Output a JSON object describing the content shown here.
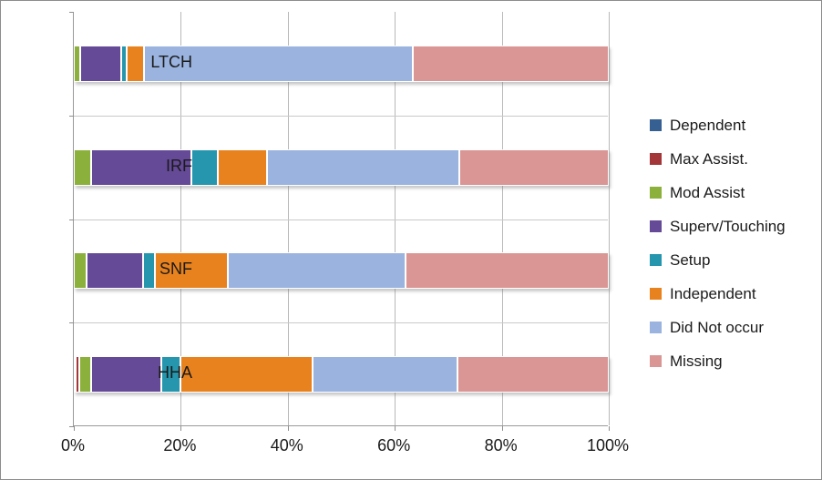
{
  "chart_data": {
    "type": "bar",
    "orientation": "horizontal",
    "stacked": true,
    "normalized_percent": true,
    "title": "",
    "xlabel": "",
    "ylabel": "",
    "xlim": [
      0,
      100
    ],
    "xticks": [
      "0%",
      "20%",
      "40%",
      "60%",
      "80%",
      "100%"
    ],
    "xtick_values": [
      0,
      20,
      40,
      60,
      80,
      100
    ],
    "grid": "vertical",
    "legend_position": "right",
    "categories": [
      "LTCH",
      "IRF",
      "SNF",
      "HHA"
    ],
    "series": [
      {
        "name": "Dependent",
        "color": "#376092",
        "values": [
          0.0,
          0.0,
          0.0,
          0.4
        ]
      },
      {
        "name": "Max Assist.",
        "color": "#a33639",
        "values": [
          0.0,
          0.0,
          0.0,
          0.6
        ]
      },
      {
        "name": "Mod Assist",
        "color": "#8cb03c",
        "values": [
          1.2,
          3.2,
          2.4,
          2.2
        ]
      },
      {
        "name": "Superv/Touching",
        "color": "#654a98",
        "values": [
          7.7,
          18.7,
          10.6,
          13.1
        ]
      },
      {
        "name": "Setup",
        "color": "#2596ad",
        "values": [
          0.9,
          5.1,
          2.2,
          3.6
        ]
      },
      {
        "name": "Independent",
        "color": "#e8821e",
        "values": [
          3.4,
          9.2,
          13.6,
          24.7
        ]
      },
      {
        "name": "Did Not occur",
        "color": "#9ab3df",
        "values": [
          50.1,
          35.9,
          33.2,
          27.2
        ]
      },
      {
        "name": "Missing",
        "color": "#d99694",
        "values": [
          36.7,
          27.9,
          38.0,
          28.2
        ]
      }
    ]
  },
  "legend": {
    "items": [
      {
        "label": "Dependent"
      },
      {
        "label": "Max Assist."
      },
      {
        "label": "Mod Assist"
      },
      {
        "label": "Superv/Touching"
      },
      {
        "label": "Setup"
      },
      {
        "label": "Independent"
      },
      {
        "label": "Did Not occur"
      },
      {
        "label": "Missing"
      }
    ]
  },
  "axis": {
    "y_categories": [
      "LTCH",
      "IRF",
      "SNF",
      "HHA"
    ],
    "x_ticks": [
      "0%",
      "20%",
      "40%",
      "60%",
      "80%",
      "100%"
    ]
  }
}
